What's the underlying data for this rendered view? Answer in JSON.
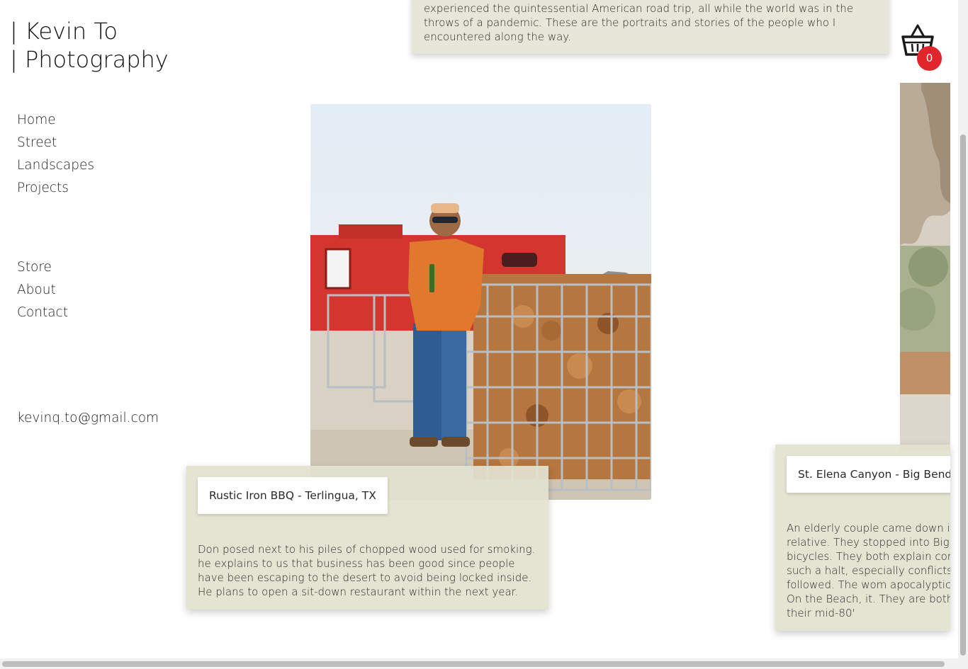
{
  "site": {
    "title_line1": "| Kevin To",
    "title_line2": "| Photography"
  },
  "nav": {
    "primary": [
      "Home",
      "Street",
      "Landscapes",
      "Projects"
    ],
    "secondary": [
      "Store",
      "About",
      "Contact"
    ],
    "email": "kevinq.to@gmail.com"
  },
  "intro": {
    "text": "experienced the quintessential American road trip, all while the world was in the throws of a pandemic. These are the portraits and stories of the people who I encountered along the way."
  },
  "cart": {
    "icon": "basket-icon",
    "count": "0",
    "badge_color": "#e0262b"
  },
  "photos": [
    {
      "title": "Rustic Iron BBQ - Terlingua, TX",
      "caption": "Don posed next to his piles of chopped wood used for smoking. he explains to us that business has been good since people have been escaping to the desert to avoid being locked inside. He plans to open a sit-down restaurant within the next year."
    },
    {
      "title": "St. Elena Canyon - Big Bend N",
      "caption": "An elderly couple came down in a relative. They stopped into Big their bicycles. They both explain come to such a halt, especially conflicts that followed. The wom apocalyptic film On the Beach, it. They are both in their mid-80'"
    }
  ],
  "colors": {
    "card_background": "#e7e7d9",
    "caption_background": "#e2e2d0"
  }
}
